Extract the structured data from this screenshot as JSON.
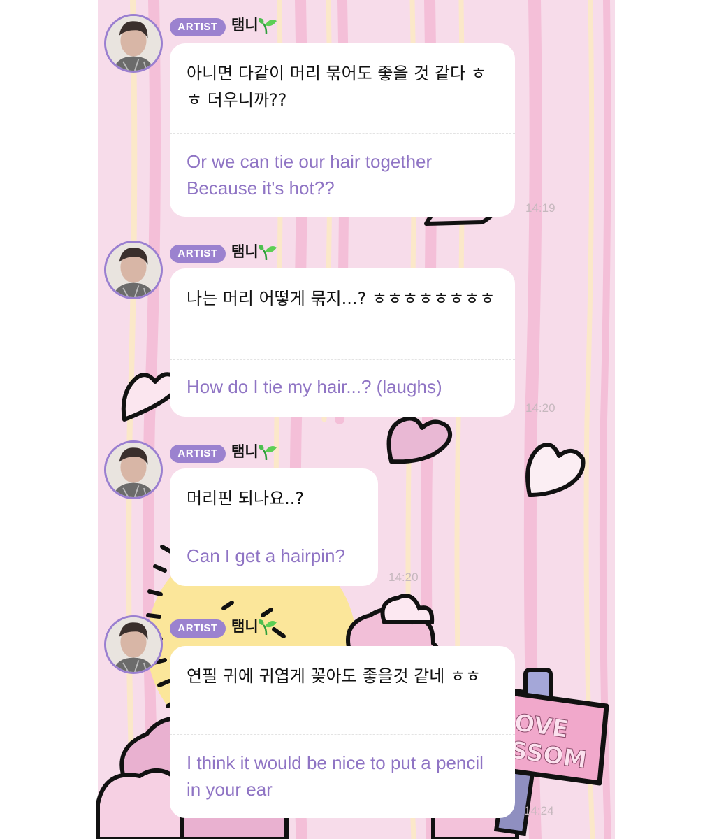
{
  "messages": [
    {
      "badge": "ARTIST",
      "name": "탬니",
      "korean": "아니면 다같이 머리 묶어도 좋을 것 같다 ㅎㅎ 더우니까??",
      "english": "Or we can tie our hair together Because it's hot??",
      "time": "14:19"
    },
    {
      "badge": "ARTIST",
      "name": "탬니",
      "korean": "나는 머리 어떻게 묶지...? ㅎㅎㅎㅎㅎㅎㅎㅎ",
      "english": "How do I tie my hair...? (laughs)",
      "time": "14:20"
    },
    {
      "badge": "ARTIST",
      "name": "탬니",
      "korean": "머리핀 되나요..?",
      "english": "Can I get a hairpin?",
      "time": "14:20"
    },
    {
      "badge": "ARTIST",
      "name": "탬니",
      "korean": "연필 귀에 귀엽게 꽂아도 좋을것 같네 ㅎㅎ",
      "english": "I think it would be nice to put a pencil in your ear",
      "time": "14:24"
    }
  ],
  "background": {
    "sign_text_line1": "OVE",
    "sign_text_line2": "SSOM"
  },
  "icons": {
    "sprout": "sprout-icon",
    "avatar": "artist-avatar"
  },
  "colors": {
    "background": "#f8e1ee",
    "badge": "#9b82cf",
    "translation_text": "#8f74c4",
    "avatar_ring": "#9a7fd0"
  }
}
